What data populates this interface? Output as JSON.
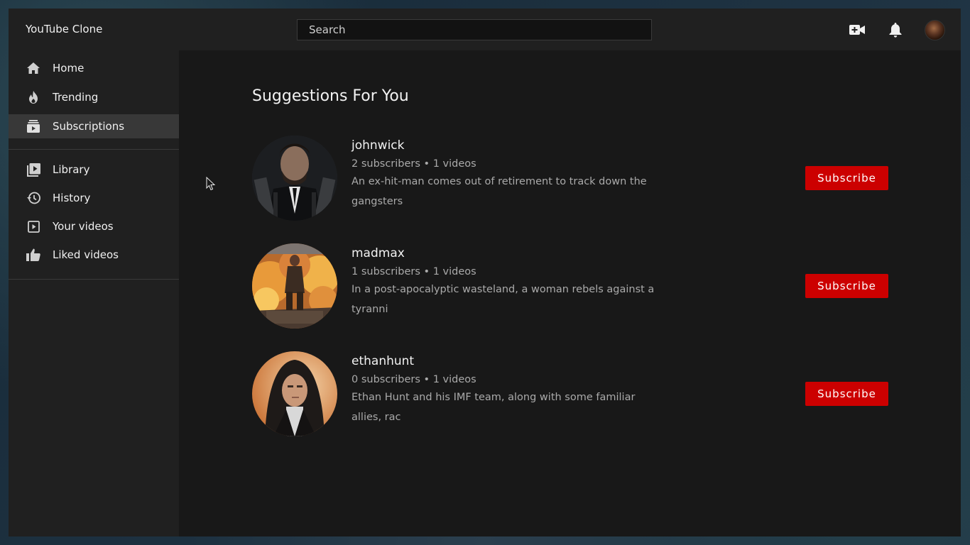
{
  "app": {
    "title": "YouTube Clone"
  },
  "search": {
    "placeholder": "Search"
  },
  "header_icons": [
    "video-camera-add-icon",
    "bell-icon",
    "avatar"
  ],
  "sidebar": {
    "primary": [
      {
        "label": "Home",
        "icon": "home-icon"
      },
      {
        "label": "Trending",
        "icon": "fire-icon"
      },
      {
        "label": "Subscriptions",
        "icon": "subscriptions-icon",
        "active": true
      }
    ],
    "secondary": [
      {
        "label": "Library",
        "icon": "library-icon"
      },
      {
        "label": "History",
        "icon": "history-icon"
      },
      {
        "label": "Your videos",
        "icon": "your-videos-icon"
      },
      {
        "label": "Liked videos",
        "icon": "thumbs-up-icon"
      }
    ]
  },
  "main": {
    "title": "Suggestions For You",
    "channels": [
      {
        "name": "johnwick",
        "meta": "2 subscribers • 1 videos",
        "description": "An ex-hit-man comes out of retirement to track down the gangsters",
        "button": "Subscribe"
      },
      {
        "name": "madmax",
        "meta": "1 subscribers • 1 videos",
        "description": "In a post-apocalyptic wasteland, a woman rebels against a tyranni",
        "button": "Subscribe"
      },
      {
        "name": "ethanhunt",
        "meta": "0 subscribers • 1 videos",
        "description": "Ethan Hunt and his IMF team, along with some familiar allies, rac",
        "button": "Subscribe"
      }
    ]
  },
  "colors": {
    "accent": "#cc0000",
    "sidebar_bg": "#202020",
    "main_bg": "#181818",
    "active_item": "#383838"
  }
}
